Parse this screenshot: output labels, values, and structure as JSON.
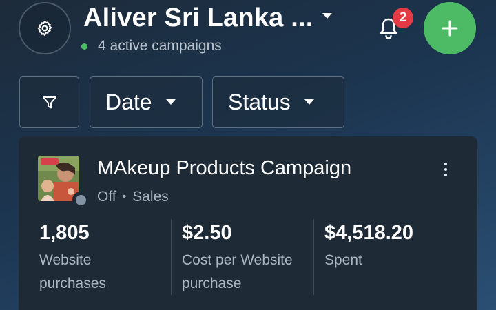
{
  "header": {
    "account_name": "Aliver Sri Lanka ...",
    "status_text": "4 active campaigns",
    "notification_count": "2",
    "status_dot_color": "#4fbf6a",
    "add_button_color": "#4dbb66",
    "badge_color": "#e23b44"
  },
  "icons": {
    "settings": "gear-icon",
    "notifications": "bell-icon",
    "add": "plus-icon",
    "filter": "filter-icon",
    "dropdown": "chevron-down-icon",
    "more": "more-vertical-icon"
  },
  "filters": {
    "date_label": "Date",
    "status_label": "Status"
  },
  "campaign": {
    "name": "MAkeup Products Campaign",
    "state": "Off",
    "separator": "•",
    "objective": "Sales",
    "metrics": [
      {
        "value": "1,805",
        "label_line1": "Website",
        "label_line2": "purchases"
      },
      {
        "value": "$2.50",
        "label_line1": "Cost per Website",
        "label_line2": "purchase"
      },
      {
        "value": "$4,518.20",
        "label_line1": "Spent",
        "label_line2": ""
      }
    ]
  }
}
